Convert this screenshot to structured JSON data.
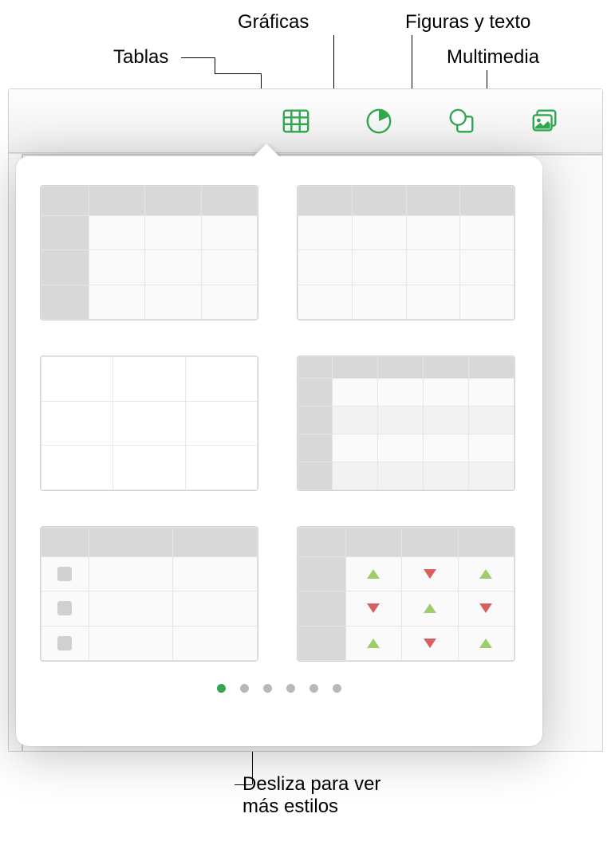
{
  "callouts": {
    "tables": "Tablas",
    "charts": "Gráficas",
    "shapes_text": "Figuras y texto",
    "media": "Multimedia",
    "swipe_hint": "Desliza para ver\nmás estilos"
  },
  "toolbar": {
    "accent": "#2fa84f",
    "buttons": {
      "tables": "tables-icon",
      "charts": "chart-icon",
      "shapes": "shapes-icon",
      "media": "media-icon"
    }
  },
  "popover": {
    "styles": [
      {
        "id": "header-left",
        "desc": "table-style-header-row-and-column"
      },
      {
        "id": "header-top",
        "desc": "table-style-header-row-only"
      },
      {
        "id": "plain",
        "desc": "table-style-plain-grid"
      },
      {
        "id": "banded",
        "desc": "table-style-banded-with-headers"
      },
      {
        "id": "checklist",
        "desc": "table-style-checklist"
      },
      {
        "id": "indicators",
        "desc": "table-style-up-down-indicators"
      }
    ],
    "page_count": 6,
    "active_page": 0
  }
}
